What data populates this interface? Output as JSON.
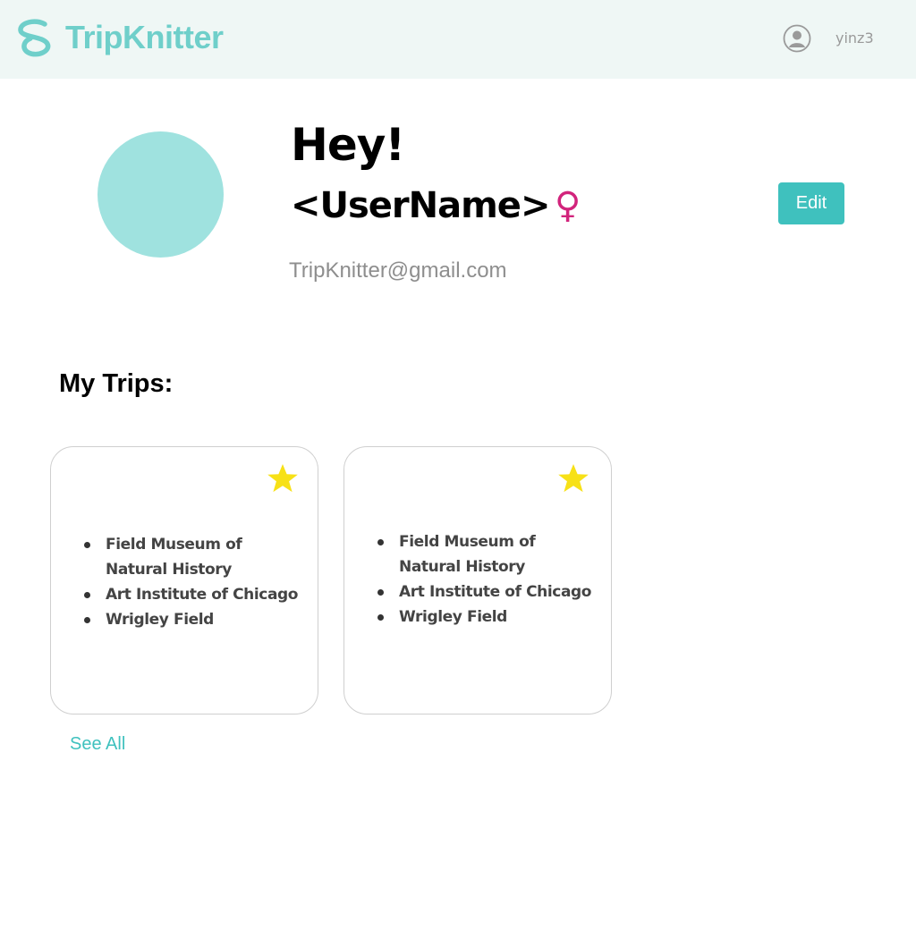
{
  "header": {
    "brand": "TripKnitter",
    "username": "yinz3",
    "logo_icon": "knot-logo-icon",
    "user_icon": "user-circle-icon"
  },
  "profile": {
    "greeting": "Hey!",
    "name": "<UserName>",
    "gender_symbol": "♀",
    "email": "TripKnitter@gmail.com",
    "edit_label": "Edit"
  },
  "trips": {
    "title": "My Trips:",
    "cards": [
      {
        "star_icon": "star-icon",
        "places": [
          "Field Museum of Natural History",
          "Art Institute of Chicago",
          "Wrigley Field"
        ]
      },
      {
        "star_icon": "star-icon",
        "places": [
          "Field Museum of Natural History",
          "Art Institute of Chicago",
          "Wrigley Field"
        ]
      }
    ],
    "see_all_label": "See All"
  },
  "colors": {
    "brand": "#6fcfca",
    "accent": "#3fc1be",
    "avatar": "#9fe2df",
    "star": "#f7e117",
    "gender": "#d2247c",
    "header_bg": "#eff7f5"
  }
}
